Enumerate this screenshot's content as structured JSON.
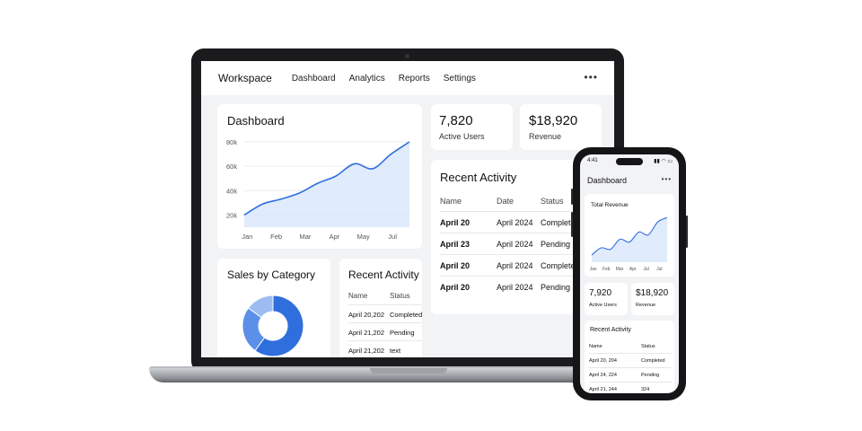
{
  "laptop": {
    "nav": {
      "brand": "Workspace",
      "links": [
        "Dashboard",
        "Analytics",
        "Reports",
        "Settings"
      ],
      "more_icon": "more-horizontal-icon"
    },
    "dashboard_card": {
      "title": "Dashboard",
      "chart_data": {
        "type": "area",
        "categories": [
          "Jan",
          "Feb",
          "Mar",
          "Apr",
          "May",
          "Jul"
        ],
        "y_ticks": [
          "80k",
          "60k",
          "40k",
          "20k"
        ],
        "ylim": [
          10000,
          80000
        ],
        "values": [
          20000,
          29000,
          33000,
          38000,
          46000,
          52000,
          62000,
          58000,
          70000,
          80000
        ],
        "grid": true,
        "color": "#2f6fdd"
      }
    },
    "stat_users": {
      "value": "7,820",
      "label": "Active Users"
    },
    "stat_revenue": {
      "value": "$18,920",
      "label": "Revenue"
    },
    "recent_activity": {
      "title": "Recent Activity",
      "columns": [
        "Name",
        "Date",
        "Status"
      ],
      "rows": [
        {
          "name": "April 20",
          "date": "April 2024",
          "status": "Completed"
        },
        {
          "name": "April 23",
          "date": "April 2024",
          "status": "Pending"
        },
        {
          "name": "April 20",
          "date": "April 2024",
          "status": "Completed"
        },
        {
          "name": "April 20",
          "date": "April 2024",
          "status": "Pending"
        }
      ]
    },
    "sales_card": {
      "title": "Sales by Category",
      "chart_data": {
        "type": "pie",
        "slices": [
          {
            "value": 60,
            "color": "#2f6fdd"
          },
          {
            "value": 25,
            "color": "#5b8fe8"
          },
          {
            "value": 15,
            "color": "#9dbdf2"
          }
        ]
      }
    },
    "recent_activity_small": {
      "title": "Recent Activity",
      "columns": [
        "Name",
        "Status"
      ],
      "rows": [
        {
          "name": "April 20,202",
          "status": "Completed"
        },
        {
          "name": "April 21,202",
          "status": "Pending"
        },
        {
          "name": "April 21,202",
          "status": "text"
        }
      ]
    }
  },
  "phone": {
    "status_time": "4:41",
    "title": "Dashboard",
    "more_icon": "more-horizontal-icon",
    "revenue_card": {
      "title": "Total Revenue",
      "chart_data": {
        "type": "area",
        "categories": [
          "Jan",
          "Feb",
          "Mar",
          "Apr",
          "Jul",
          "Jul"
        ],
        "values": [
          20000,
          30000,
          28000,
          42000,
          38000,
          52000,
          48000,
          66000,
          72000
        ],
        "ylim": [
          10000,
          80000
        ],
        "color": "#2f6fdd"
      }
    },
    "stat_users": {
      "value": "7,920",
      "label": "Active Users"
    },
    "stat_revenue": {
      "value": "$18,920",
      "label": "Revenue"
    },
    "recent_activity": {
      "title": "Recent Activity",
      "columns": [
        "Name",
        "Status"
      ],
      "rows": [
        {
          "name": "April 20, 204",
          "status": "Completed"
        },
        {
          "name": "April 24, 224",
          "status": "Pending"
        },
        {
          "name": "April 21, 244",
          "status": "324"
        }
      ]
    }
  }
}
